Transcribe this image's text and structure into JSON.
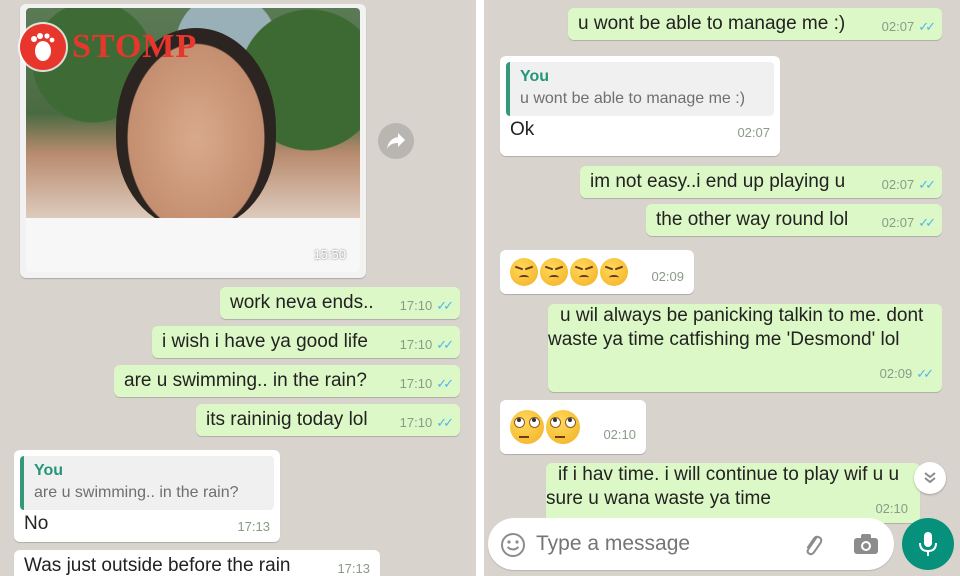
{
  "watermark": {
    "brand": "STOMP"
  },
  "left_chat": {
    "photo": {
      "time": "15:50"
    },
    "messages": [
      {
        "text": "work neva ends..",
        "time": "17:10"
      },
      {
        "text": "i wish i have ya good life",
        "time": "17:10"
      },
      {
        "text": "are u swimming.. in the rain?",
        "time": "17:10"
      },
      {
        "text": "its raininig today lol",
        "time": "17:10"
      }
    ],
    "reply": {
      "quote_name": "You",
      "quote_text": "are u swimming.. in the rain?",
      "text": "No",
      "time": "17:13"
    },
    "last": {
      "text": "Was just outside before the rain",
      "time": "17:13"
    }
  },
  "right_chat": {
    "messages": [
      {
        "text": "u wont be able to manage me :)",
        "time": "02:07"
      },
      {
        "text": "im not easy..i end up playing u",
        "time": "02:07"
      },
      {
        "text": "the other way round lol",
        "time": "02:07"
      },
      {
        "text": "u wil always be panicking talkin to me. dont waste ya time catfishing me 'Desmond' lol",
        "time": "02:09"
      },
      {
        "text": "if i hav time.  i will continue to play wif u u sure u wana waste ya time",
        "time": "02:10"
      }
    ],
    "reply": {
      "quote_name": "You",
      "quote_text": "u wont be able to manage me :)",
      "text": "Ok",
      "time": "02:07"
    },
    "emoji1": {
      "time": "02:09"
    },
    "emoji2": {
      "time": "02:10"
    }
  },
  "compose": {
    "placeholder": "Type a message"
  },
  "colors": {
    "outgoing": "#dcf8c6",
    "incoming": "#ffffff",
    "accent": "#07917d",
    "ticks": "#4fb6ec"
  }
}
